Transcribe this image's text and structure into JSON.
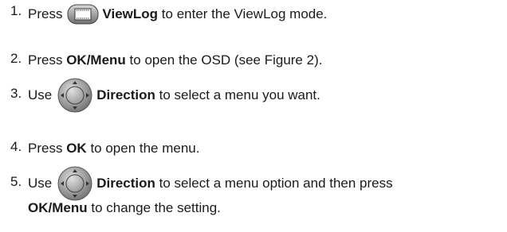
{
  "steps": [
    {
      "num": "1.",
      "before": "Press",
      "bold": "ViewLog",
      "after": "to enter the ViewLog mode.",
      "icon": "viewlog-button-icon"
    },
    {
      "num": "2.",
      "before": "Press",
      "bold": "OK/Menu",
      "after": "to open the OSD (see Figure 2)."
    },
    {
      "num": "3.",
      "before": "Use",
      "bold": "Direction",
      "after": "to select a menu you want.",
      "icon": "direction-pad-icon"
    },
    {
      "num": "4.",
      "before": "Press",
      "bold": "OK",
      "after": "to open the menu."
    },
    {
      "num": "5.",
      "before": "Use",
      "bold": "Direction",
      "after": "to select a menu option and then press",
      "bold2": "OK/Menu",
      "after2": "to change the setting.",
      "icon": "direction-pad-icon"
    }
  ]
}
